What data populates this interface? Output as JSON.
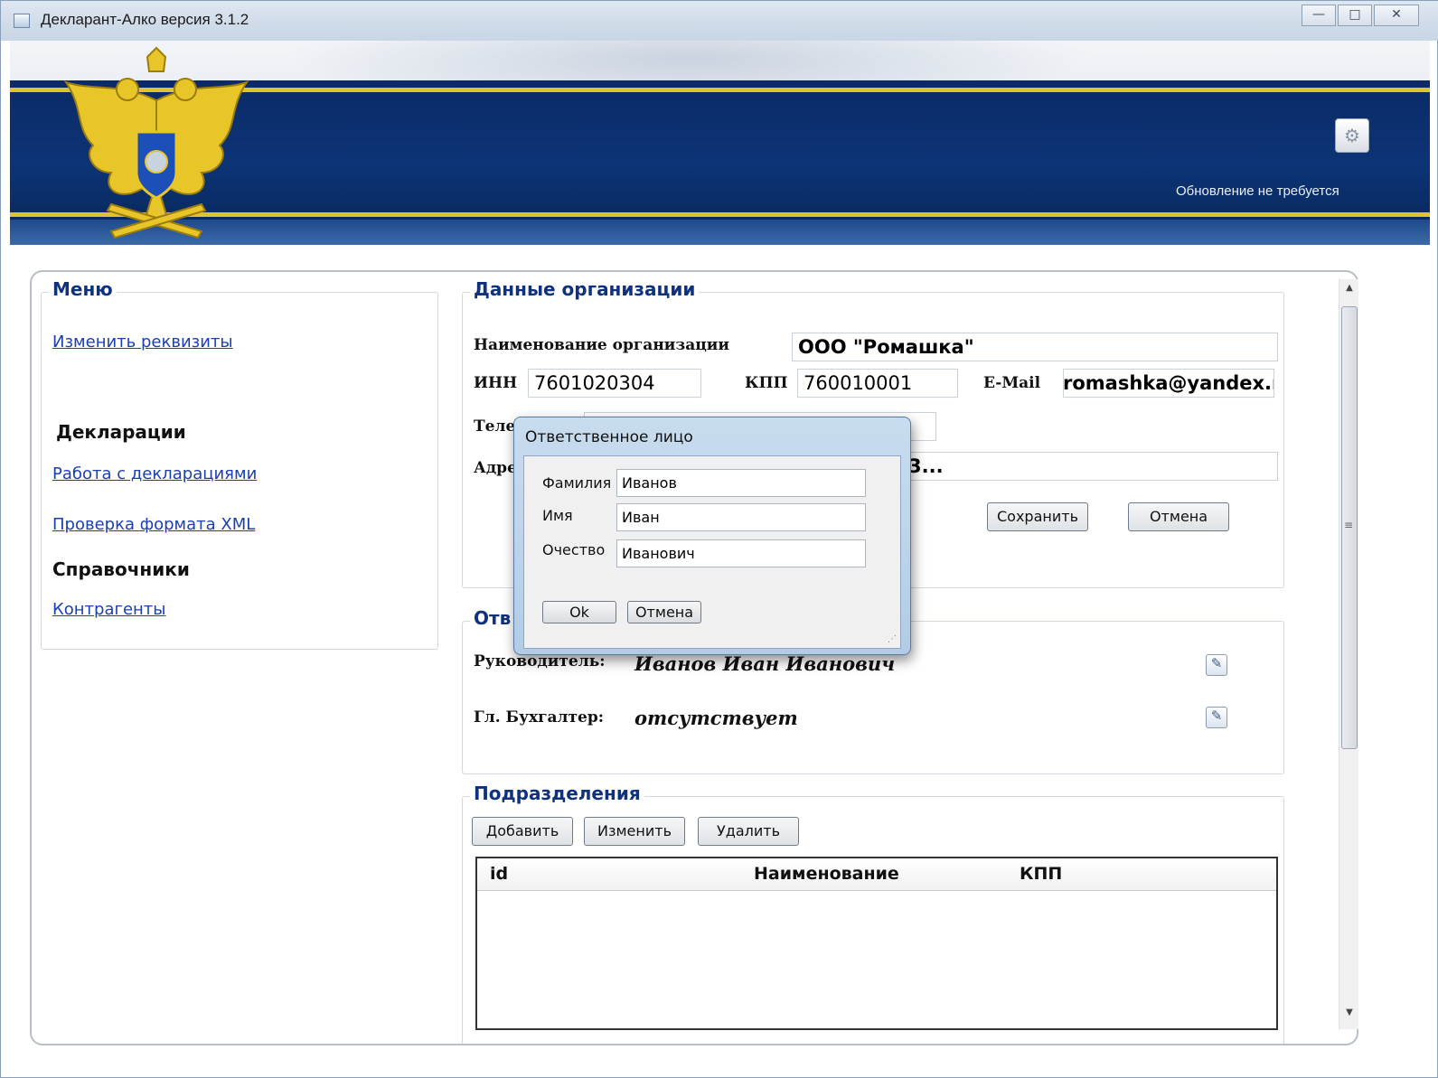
{
  "window": {
    "title": "Декларант-Алко версия 3.1.2",
    "buttons": {
      "minimize": "—",
      "maximize": "□",
      "close": "✕"
    }
  },
  "header": {
    "update_status": "Обновление не требуется",
    "settings_icon": "gear-icon",
    "emblem": "coat-of-arms"
  },
  "menu": {
    "title": "Меню",
    "change_requisites": "Изменить реквизиты",
    "declarations_header": "Декларации",
    "work_with_declarations": "Работа с декларациями",
    "check_xml_format": "Проверка формата XML",
    "references_header": "Справочники",
    "counterparties": "Контрагенты"
  },
  "org": {
    "title": "Данные организации",
    "name_label": "Наименование организации",
    "name_value": "ООО \"Ромашка\"",
    "inn_label": "ИНН",
    "inn_value": "7601020304",
    "kpp_label": "КПП",
    "kpp_value": "760010001",
    "email_label": "E-Mail",
    "email_value": "romashka@yandex.ru",
    "phone_label_partial": "Теле",
    "address_label_partial": "Адре",
    "address_tail": "3...",
    "save_button": "Сохранить",
    "cancel_button": "Отмена"
  },
  "responsible": {
    "title_partial": "Отв",
    "head_label": "Руководитель:",
    "head_value": "Иванов Иван Иванович",
    "accountant_label": "Гл. Бухгалтер:",
    "accountant_value": "отсутствует",
    "edit_icon": "edit-icon"
  },
  "divisions": {
    "title": "Подразделения",
    "add_button": "Добавить",
    "edit_button": "Изменить",
    "delete_button": "Удалить",
    "columns": [
      "id",
      "Наименование",
      "КПП"
    ],
    "rows": []
  },
  "dialog": {
    "title": "Ответственное лицо",
    "surname_label": "Фамилия",
    "surname_value": "Иванов",
    "name_label": "Имя",
    "name_value": "Иван",
    "patronymic_label": "Очество",
    "patronymic_value": "Иванович",
    "ok_button": "Ok",
    "cancel_button": "Отмена"
  }
}
